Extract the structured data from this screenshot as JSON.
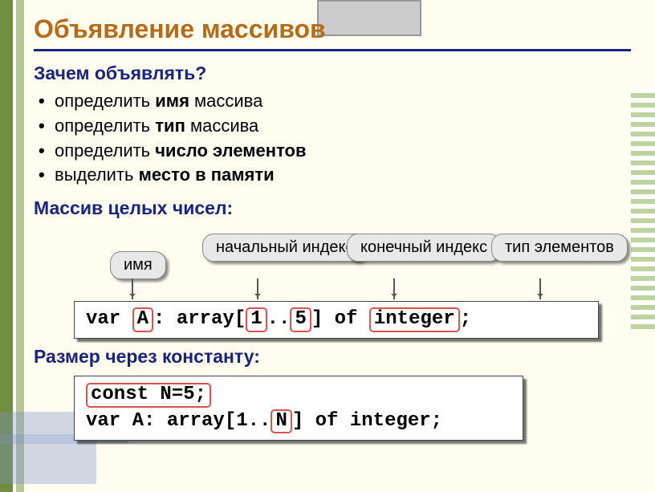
{
  "title": "Объявление массивов",
  "why": {
    "heading": "Зачем объявлять?",
    "items": [
      {
        "pre": "определить ",
        "strong": "имя",
        "post": " массива"
      },
      {
        "pre": "определить ",
        "strong": "тип",
        "post": " массива"
      },
      {
        "pre": "определить ",
        "strong": "число элементов",
        "post": ""
      },
      {
        "pre": "выделить ",
        "strong": "место в памяти",
        "post": ""
      }
    ]
  },
  "intArrayHeading": "Массив целых чисел:",
  "callouts": {
    "name": "имя",
    "startIdx": "начальный\nиндекс",
    "endIdx": "конечный\nиндекс",
    "elemType": "тип\nэлементов"
  },
  "decl": {
    "p1": "var ",
    "name": "A",
    "p2": ": array[",
    "lo": "1",
    "p3": "..",
    "hi": "5",
    "p4": "] of ",
    "typ": "integer",
    "p5": ";"
  },
  "constHeading": "Размер через константу:",
  "constDecl": {
    "line1": "const N=5;",
    "l2a": "var A: array[1..",
    "l2N": "N",
    "l2b": "] of integer;"
  }
}
